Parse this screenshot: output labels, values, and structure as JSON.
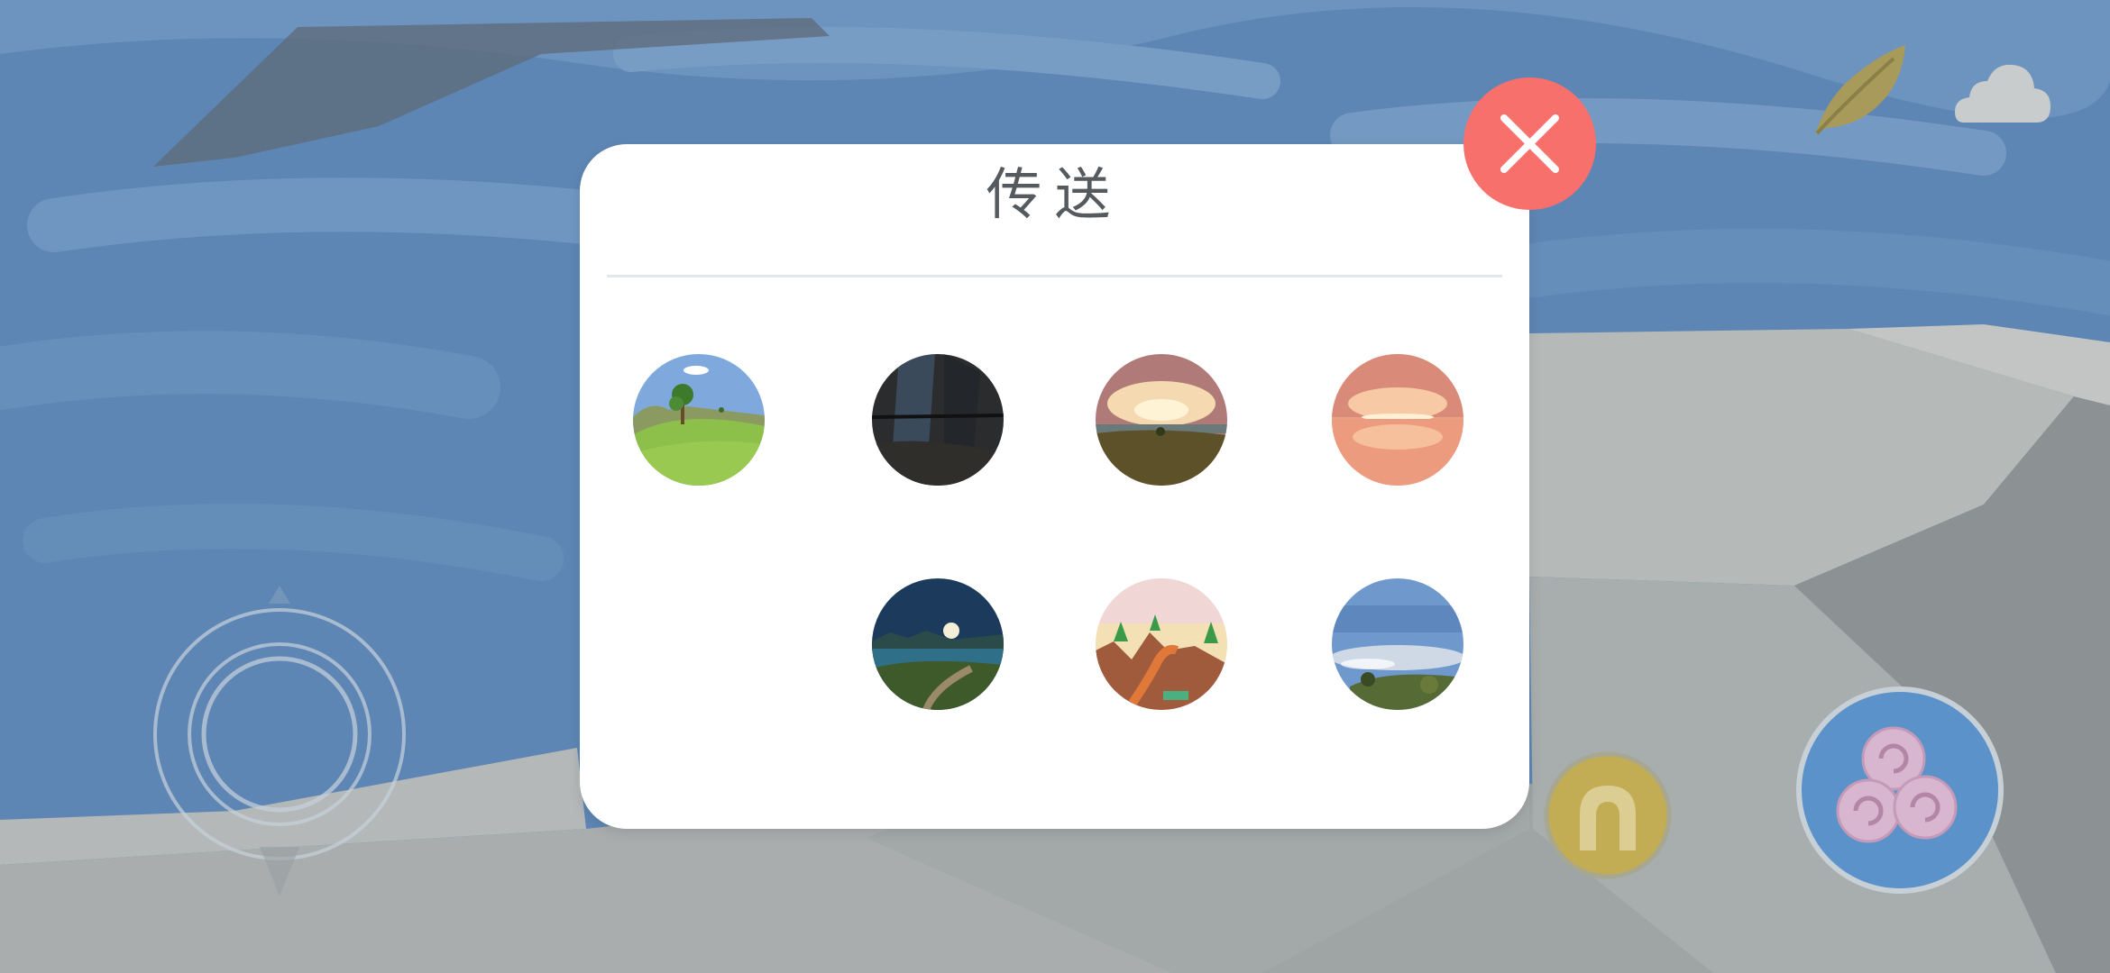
{
  "teleport_panel": {
    "title": "传送",
    "close_icon": "close-icon",
    "destinations": [
      {
        "id": "meadow",
        "icon": "meadow-destination-icon"
      },
      {
        "id": "cave",
        "icon": "cave-destination-icon"
      },
      {
        "id": "sunset-hill",
        "icon": "sunset-hill-destination-icon"
      },
      {
        "id": "sunset-sea",
        "icon": "sunset-sea-destination-icon"
      },
      {
        "id": "moonlit-lake",
        "icon": "moonlit-lake-destination-icon"
      },
      {
        "id": "canyon-trail",
        "icon": "canyon-trail-destination-icon"
      },
      {
        "id": "sky-clouds",
        "icon": "cloud-sea-destination-icon"
      }
    ]
  },
  "hud": {
    "top_right_icons": [
      "feather-icon",
      "cloud-icon"
    ],
    "joystick_icon": "joystick-icon",
    "action_buttons": [
      "horseshoe-icon",
      "swirl-icon"
    ]
  },
  "colors": {
    "sky": "#5f86b4",
    "rock": "#b9bcbc",
    "close_button": "#f7706b",
    "swirl_button": "#5b92c9",
    "horseshoe_button": "#c9b35a"
  }
}
